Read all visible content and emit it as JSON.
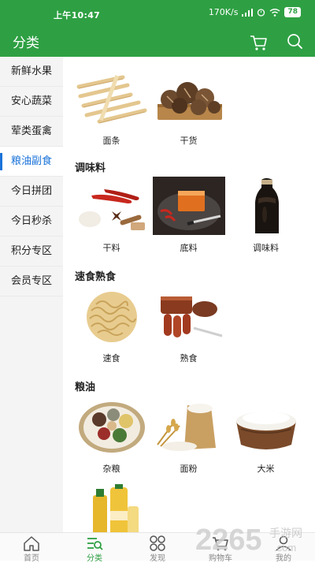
{
  "status_bar": {
    "time": "上午10:47",
    "network_speed": "170K/s",
    "battery": "78"
  },
  "app_bar": {
    "title": "分类",
    "cart_icon": "cart-icon",
    "search_icon": "search-icon"
  },
  "sidebar": {
    "items": [
      {
        "label": "新鲜水果"
      },
      {
        "label": "安心蔬菜"
      },
      {
        "label": "荤类蛋禽"
      },
      {
        "label": "粮油副食",
        "active": true
      },
      {
        "label": "今日拼团"
      },
      {
        "label": "今日秒杀"
      },
      {
        "label": "积分专区"
      },
      {
        "label": "会员专区"
      }
    ]
  },
  "content": {
    "top_items": [
      {
        "label": "面条"
      },
      {
        "label": "干货"
      }
    ],
    "sections": [
      {
        "title": "调味料",
        "items": [
          {
            "label": "干料"
          },
          {
            "label": "底料"
          },
          {
            "label": "调味料"
          }
        ]
      },
      {
        "title": "速食熟食",
        "items": [
          {
            "label": "速食"
          },
          {
            "label": "熟食"
          }
        ]
      },
      {
        "title": "粮油",
        "items": [
          {
            "label": "杂粮"
          },
          {
            "label": "面粉"
          },
          {
            "label": "大米"
          }
        ]
      }
    ]
  },
  "bottom_nav": {
    "items": [
      {
        "label": "首页",
        "icon": "home-icon"
      },
      {
        "label": "分类",
        "icon": "category-icon",
        "active": true
      },
      {
        "label": "发现",
        "icon": "discover-icon"
      },
      {
        "label": "购物车",
        "icon": "cart-icon"
      },
      {
        "label": "我的",
        "icon": "profile-icon"
      }
    ]
  },
  "watermark": {
    "text": "2265",
    "suffix": "手游网",
    "domain": ".com"
  },
  "colors": {
    "primary_green": "#2ea043",
    "active_blue": "#1a73d9",
    "sidebar_bg": "#f4f4f4"
  }
}
